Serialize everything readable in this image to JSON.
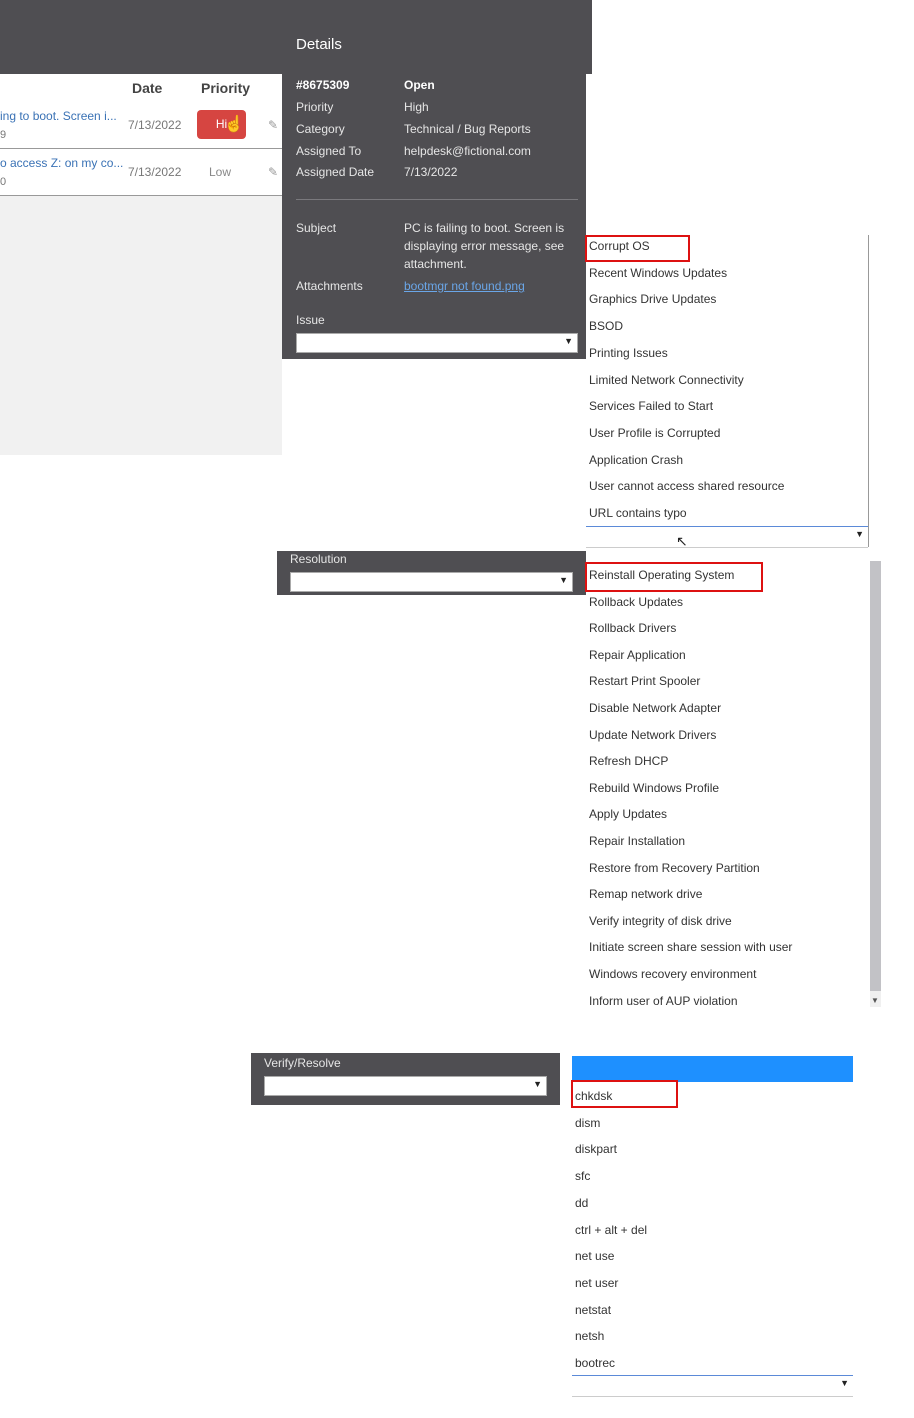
{
  "ticket_list": {
    "columns": {
      "date": "Date",
      "priority": "Priority"
    },
    "rows": [
      {
        "subject": "ing to boot. Screen i...",
        "id": "9",
        "date": "7/13/2022",
        "priority": "Hi"
      },
      {
        "subject": "o access Z: on my co...",
        "id": "0",
        "date": "7/13/2022",
        "priority": "Low"
      }
    ]
  },
  "details": {
    "title": "Details",
    "ticket_number": "#8675309",
    "status": "Open",
    "fields": [
      {
        "label": "Priority",
        "value": "High"
      },
      {
        "label": "Category",
        "value": "Technical / Bug Reports"
      },
      {
        "label": "Assigned To",
        "value": "helpdesk@fictional.com"
      },
      {
        "label": "Assigned Date",
        "value": "7/13/2022"
      }
    ],
    "subject_label": "Subject",
    "subject_value": "PC is failing to boot. Screen is displaying error message, see attachment.",
    "attachments_label": "Attachments",
    "attachment_name": "bootmgr not found.png",
    "issue_label": "Issue"
  },
  "issue_options": [
    "Corrupt OS",
    "Recent Windows Updates",
    "Graphics Drive Updates",
    "BSOD",
    "Printing Issues",
    "Limited Network Connectivity",
    "Services Failed to Start",
    "User Profile is Corrupted",
    "Application Crash",
    "User cannot access shared resource",
    "URL contains typo"
  ],
  "resolution": {
    "label": "Resolution",
    "options": [
      "Reinstall Operating System",
      "Rollback Updates",
      "Rollback Drivers",
      "Repair Application",
      "Restart Print Spooler",
      "Disable Network Adapter",
      "Update Network Drivers",
      "Refresh DHCP",
      "Rebuild Windows Profile",
      "Apply Updates",
      "Repair Installation",
      "Restore from Recovery Partition",
      "Remap network drive",
      "Verify integrity of disk drive",
      "Initiate screen share session with user",
      "Windows recovery environment",
      "Inform user of AUP violation"
    ]
  },
  "verify": {
    "label": "Verify/Resolve",
    "options": [
      "chkdsk",
      "dism",
      "diskpart",
      "sfc",
      "dd",
      "ctrl + alt + del",
      "net use",
      "net user",
      "netstat",
      "netsh",
      "bootrec"
    ]
  },
  "colors": {
    "panel": "#4f4e52",
    "highlight_box": "#dd1111",
    "priority_high": "#d64541",
    "dropdown_selected": "#1e90ff"
  }
}
